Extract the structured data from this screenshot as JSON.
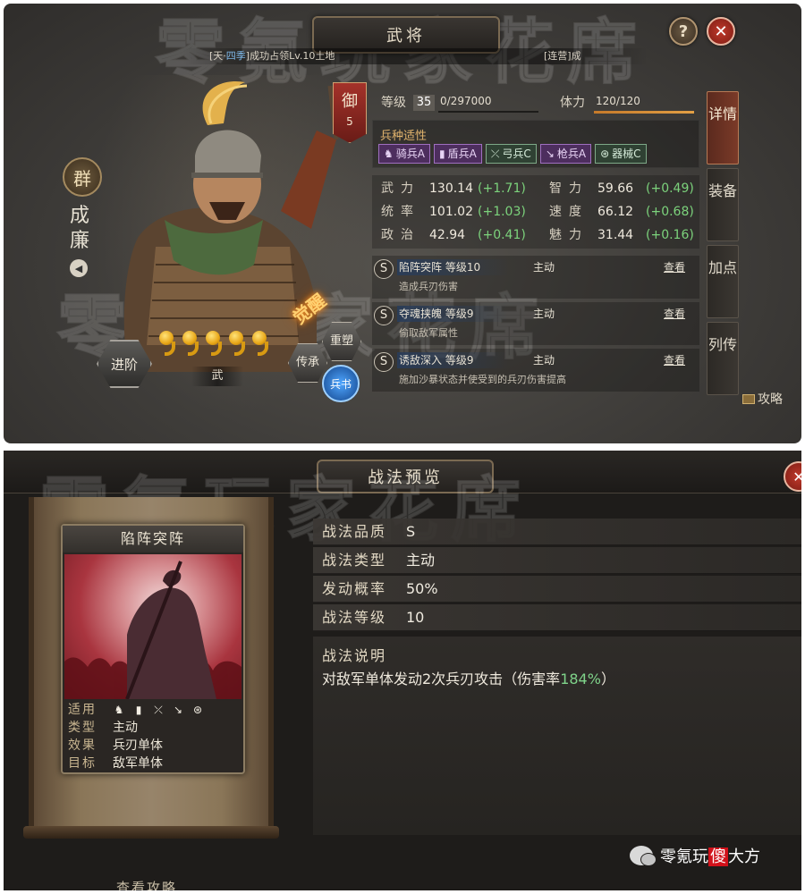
{
  "watermark": "零氪玩家花席",
  "top": {
    "title": "武将",
    "help_label": "?",
    "close_label": "✕",
    "notice": {
      "tag": "[天·",
      "tag_hl": "四季",
      "text": "]成功占领Lv.10土地",
      "tag2": "[连营]成"
    },
    "hero": {
      "faction": "群",
      "name": "成廉",
      "defense_label": "御",
      "defense_value": "5",
      "advance_label": "进阶",
      "stars": 5,
      "weapon": "武",
      "awaken": "觉醒",
      "btn_rebuild": "重塑",
      "btn_inherit": "传承",
      "btn_troop_book": "兵书"
    },
    "level": {
      "label": "等级",
      "value": "35",
      "xp": "0/297000",
      "hp_label": "体力",
      "hp": "120/120",
      "hp_fraction": 1.0
    },
    "troop": {
      "title": "兵种适性",
      "items": [
        {
          "icon": "♞",
          "label": "骑兵A",
          "style": "purple"
        },
        {
          "icon": "▮",
          "label": "盾兵A",
          "style": "purple"
        },
        {
          "icon": "⤫",
          "label": "弓兵C",
          "style": "green"
        },
        {
          "icon": "↘",
          "label": "枪兵A",
          "style": "purple"
        },
        {
          "icon": "⊛",
          "label": "器械C",
          "style": "green"
        }
      ]
    },
    "attrs": [
      {
        "name": "武力",
        "value": "130.14",
        "delta": "(+1.71)"
      },
      {
        "name": "智力",
        "value": "59.66",
        "delta": "(+0.49)"
      },
      {
        "name": "统率",
        "value": "101.02",
        "delta": "(+1.03)"
      },
      {
        "name": "速度",
        "value": "66.12",
        "delta": "(+0.68)"
      },
      {
        "name": "政治",
        "value": "42.94",
        "delta": "(+0.41)"
      },
      {
        "name": "魅力",
        "value": "31.44",
        "delta": "(+0.16)"
      }
    ],
    "skills": [
      {
        "grade": "S",
        "name": "陷阵突阵 等级10",
        "type": "主动",
        "view": "查看",
        "desc": "造成兵刃伤害"
      },
      {
        "grade": "S",
        "name": "夺魂挟魄 等级9",
        "type": "主动",
        "view": "查看",
        "desc": "偷取敌军属性"
      },
      {
        "grade": "S",
        "name": "诱敌深入 等级9",
        "type": "主动",
        "view": "查看",
        "desc": "施加沙暴状态并使受到的兵刃伤害提高"
      }
    ],
    "side_tabs": [
      "详情",
      "装备",
      "加点",
      "列传"
    ],
    "guide": "攻略"
  },
  "bottom": {
    "title": "战法预览",
    "close_label": "✕",
    "card": {
      "name": "陷阵突阵",
      "fit_label": "适用",
      "fit_icons": [
        "♞",
        "▮",
        "⤫",
        "↘",
        "⊛"
      ],
      "type_label": "类型",
      "type_value": "主动",
      "effect_label": "效果",
      "effect_value": "兵刃单体",
      "target_label": "目标",
      "target_value": "敌军单体"
    },
    "rows": [
      {
        "k": "战法品质",
        "v": "S"
      },
      {
        "k": "战法类型",
        "v": "主动"
      },
      {
        "k": "发动概率",
        "v": "50%"
      },
      {
        "k": "战法等级",
        "v": "10"
      }
    ],
    "desc_title": "战法说明",
    "desc_pre": "对敌军单体发动2次兵刃攻击（伤害率",
    "desc_hl": "184%",
    "desc_post": "）",
    "guide": "查看攻略",
    "brand_pre": "零氪玩",
    "brand_red": "傻",
    "brand_post": "大方"
  }
}
